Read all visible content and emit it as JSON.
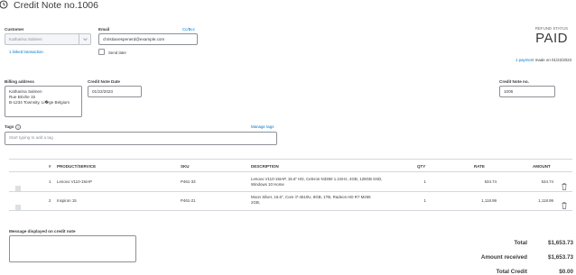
{
  "header": {
    "title": "Credit Note no.1006",
    "history_icon": "history-clock-icon"
  },
  "customer": {
    "label": "Customer",
    "value": "Katharina Salmen",
    "linked_link": "1 linked transaction"
  },
  "email": {
    "label": "Email",
    "ccbcc_link": "Cc/Bcc",
    "value": "christianespenerd@example.com",
    "send_later_label": "Send later"
  },
  "status": {
    "label": "REFUND STATUS",
    "value": "PAID",
    "payment_link": "1 payment",
    "payment_text": "made on 01/22/2023"
  },
  "billing": {
    "label": "Billing address",
    "lines": [
      "Katharina Salmen",
      "Rue Brixhe 15",
      "B-1234 Townsity, Li�ge Belgium"
    ]
  },
  "credit_note_date": {
    "label": "Credit Note Date",
    "value": "01/22/2023"
  },
  "credit_note_no": {
    "label": "Credit Note no.",
    "value": "1006"
  },
  "tags": {
    "label": "Tags",
    "manage_link": "Manage tags",
    "placeholder": "Start typing to add a tag"
  },
  "table": {
    "headers": {
      "num": "#",
      "product": "PRODUCT/SERVICE",
      "sku": "SKU",
      "description": "DESCRIPTION",
      "qty": "QTY",
      "rate": "RATE",
      "amount": "AMOUNT"
    },
    "rows": [
      {
        "num": "1",
        "product": "Lenovo V110-15IAP",
        "sku": "P461-33",
        "description": "Lenovo V110-15IAP, 15.6\" HD, Celeron N3350 1.1GHz, 4GB, 128GB SSD, Windows 10 Home",
        "qty": "1",
        "rate": "534.74",
        "amount": "534.74"
      },
      {
        "num": "2",
        "product": "Inspiron 15",
        "sku": "P461-21",
        "description": "Moon Silver, 15.6\", Core i7-4510U, 8GB, 1TB, Radeon HD R7 M265 2GB,",
        "qty": "1",
        "rate": "1,118.99",
        "amount": "1,118.99"
      }
    ]
  },
  "totals": {
    "total_label": "Total",
    "total_value": "$1,653.73",
    "received_label": "Amount received",
    "received_value": "$1,653.73",
    "credit_label": "Total Credit",
    "credit_value": "$0.00"
  },
  "message": {
    "label": "Message displayed on credit note"
  }
}
